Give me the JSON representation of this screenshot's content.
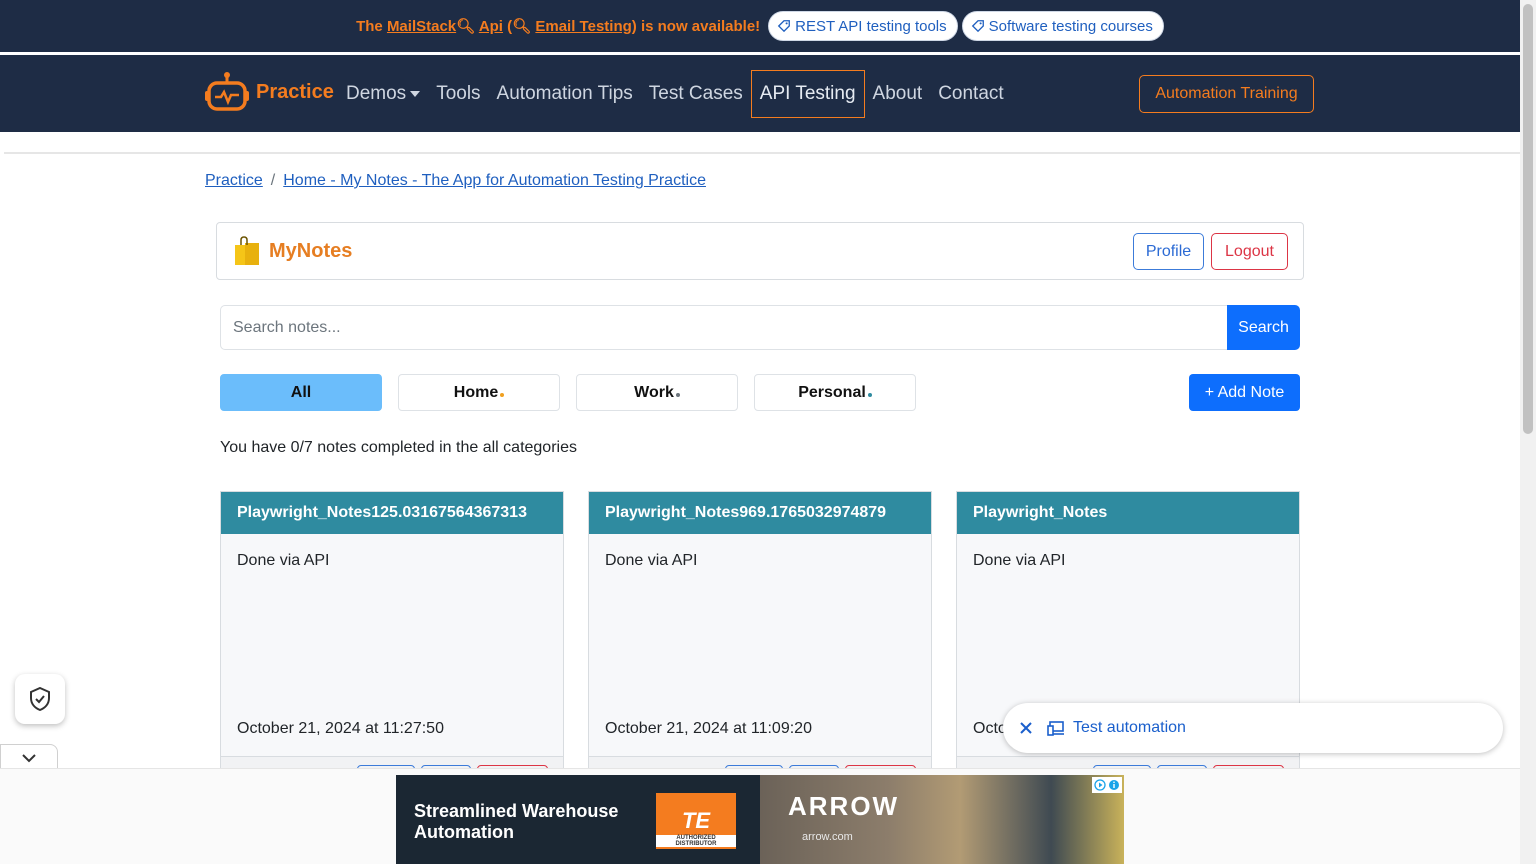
{
  "promo": {
    "text_prefix": "The ",
    "mailstack": "MailStack",
    "api": "Api",
    "paren_open": " (",
    "email_testing": "Email Testing",
    "text_suffix": ") is now available!",
    "pill1": "REST API testing tools",
    "pill2": "Software testing courses"
  },
  "navbar": {
    "brand": "Practice",
    "links": [
      "Demos",
      "Tools",
      "Automation Tips",
      "Test Cases",
      "API Testing",
      "About",
      "Contact"
    ],
    "training": "Automation Training"
  },
  "breadcrumb": {
    "root": "Practice",
    "sep": "/",
    "current": "Home - My Notes - The App for Automation Testing Practice"
  },
  "app": {
    "title": "MyNotes",
    "profile": "Profile",
    "logout": "Logout"
  },
  "search": {
    "placeholder": "Search notes...",
    "button": "Search"
  },
  "tabs": [
    {
      "label": "All",
      "active": true
    },
    {
      "label": "Home",
      "dot_color": "#f0a020"
    },
    {
      "label": "Work",
      "dot_color": "#6c757d"
    },
    {
      "label": "Personal",
      "dot_color": "#2f8ba0"
    }
  ],
  "add_note": "+ Add Note",
  "progress_text": "You have 0/7 notes completed in the all categories",
  "notes": [
    {
      "title": "Playwright_Notes125.03167564367313",
      "body": "Done via API",
      "date": "October 21, 2024 at 11:27:50"
    },
    {
      "title": "Playwright_Notes969.1765032974879",
      "body": "Done via API",
      "date": "October 21, 2024 at 11:09:20"
    },
    {
      "title": "Playwright_Notes",
      "body": "Done via API",
      "date": "Octo"
    }
  ],
  "suggestion": {
    "label": "Test automation"
  },
  "ad": {
    "headline": "Streamlined Warehouse Automation",
    "te": "TE",
    "te_sub": "AUTHORIZED DISTRIBUTOR",
    "arrow": "ARROW",
    "arrow_sub": "arrow.com"
  },
  "colors": {
    "navbar_bg": "#1e2c45",
    "accent_orange": "#f47c1f",
    "primary_blue": "#0d6efd",
    "card_header": "#2f8ba0"
  }
}
